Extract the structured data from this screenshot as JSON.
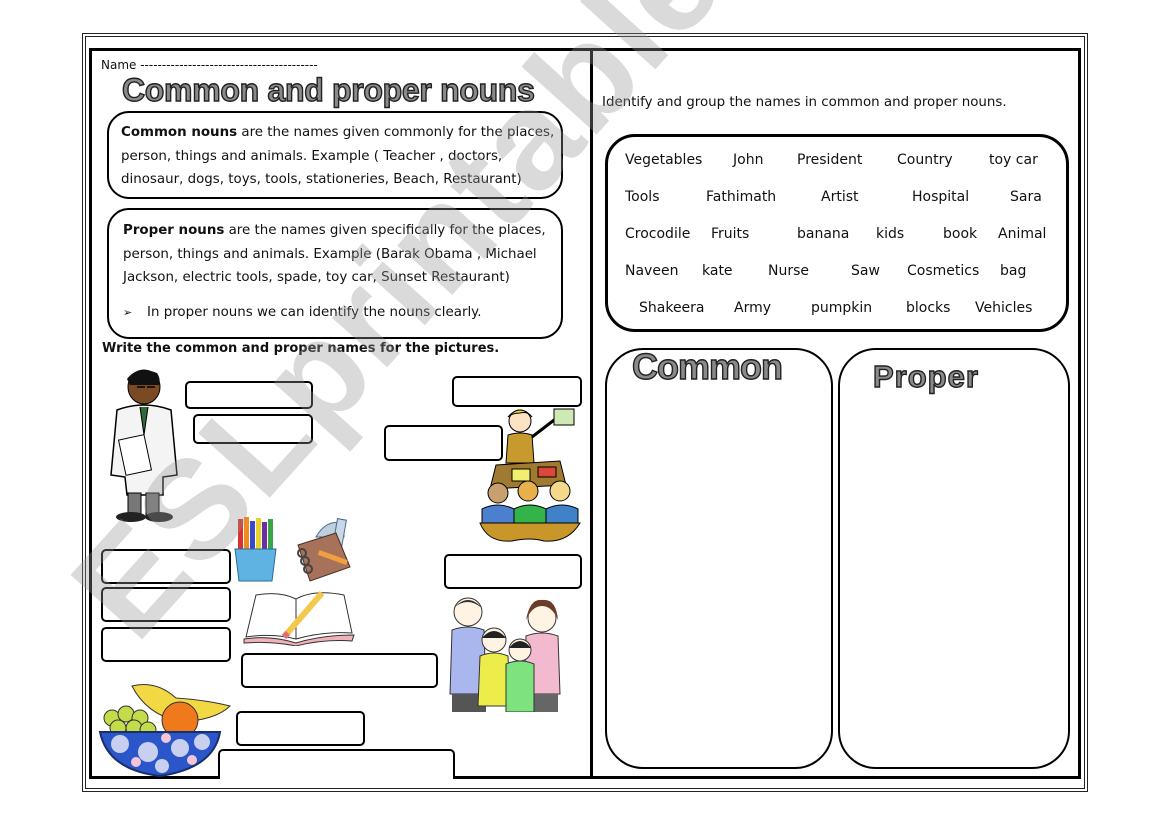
{
  "header": {
    "name_line": "Name -----------------------------------------",
    "title": "Common and proper nouns"
  },
  "common_definition": {
    "term": "Common  nouns",
    "text": " are the names given commonly for the places, person, things and animals. Example  ( Teacher , doctors, dinosaur, dogs, toys, tools, stationeries, Beach, Restaurant)"
  },
  "proper_definition": {
    "term": "Proper nouns",
    "text": " are the names given specifically for the places, person, things and animals. Example (Barak Obama , Michael Jackson, electric tools, spade, toy car, Sunset Restaurant)",
    "bullet_glyph": "➢",
    "bullet": "In proper nouns we can identify the nouns clearly."
  },
  "picture_exercise": {
    "instruction": "Write the common and proper names for the pictures.",
    "pictures": [
      "doctor",
      "teacher-with-class",
      "stationery",
      "notebook",
      "open-book",
      "family",
      "fruit-bowl"
    ]
  },
  "grouping_exercise": {
    "instruction": "Identify and group the names in common and proper nouns.",
    "word_rows": [
      [
        "Vegetables",
        "John",
        "President",
        "Country",
        "toy car"
      ],
      [
        "Tools",
        "Fathimath",
        "Artist",
        "Hospital",
        "Sara"
      ],
      [
        "Crocodile",
        "Fruits",
        "banana",
        "kids",
        "book",
        "Animal"
      ],
      [
        "Naveen",
        "kate",
        "Nurse",
        "Saw",
        "Cosmetics",
        "bag"
      ],
      [
        "Shakeera",
        "Army",
        "pumpkin",
        "blocks",
        "Vehicles"
      ]
    ],
    "common_heading": "Common",
    "proper_heading": "Proper"
  },
  "watermark": "ESLprintables.com"
}
